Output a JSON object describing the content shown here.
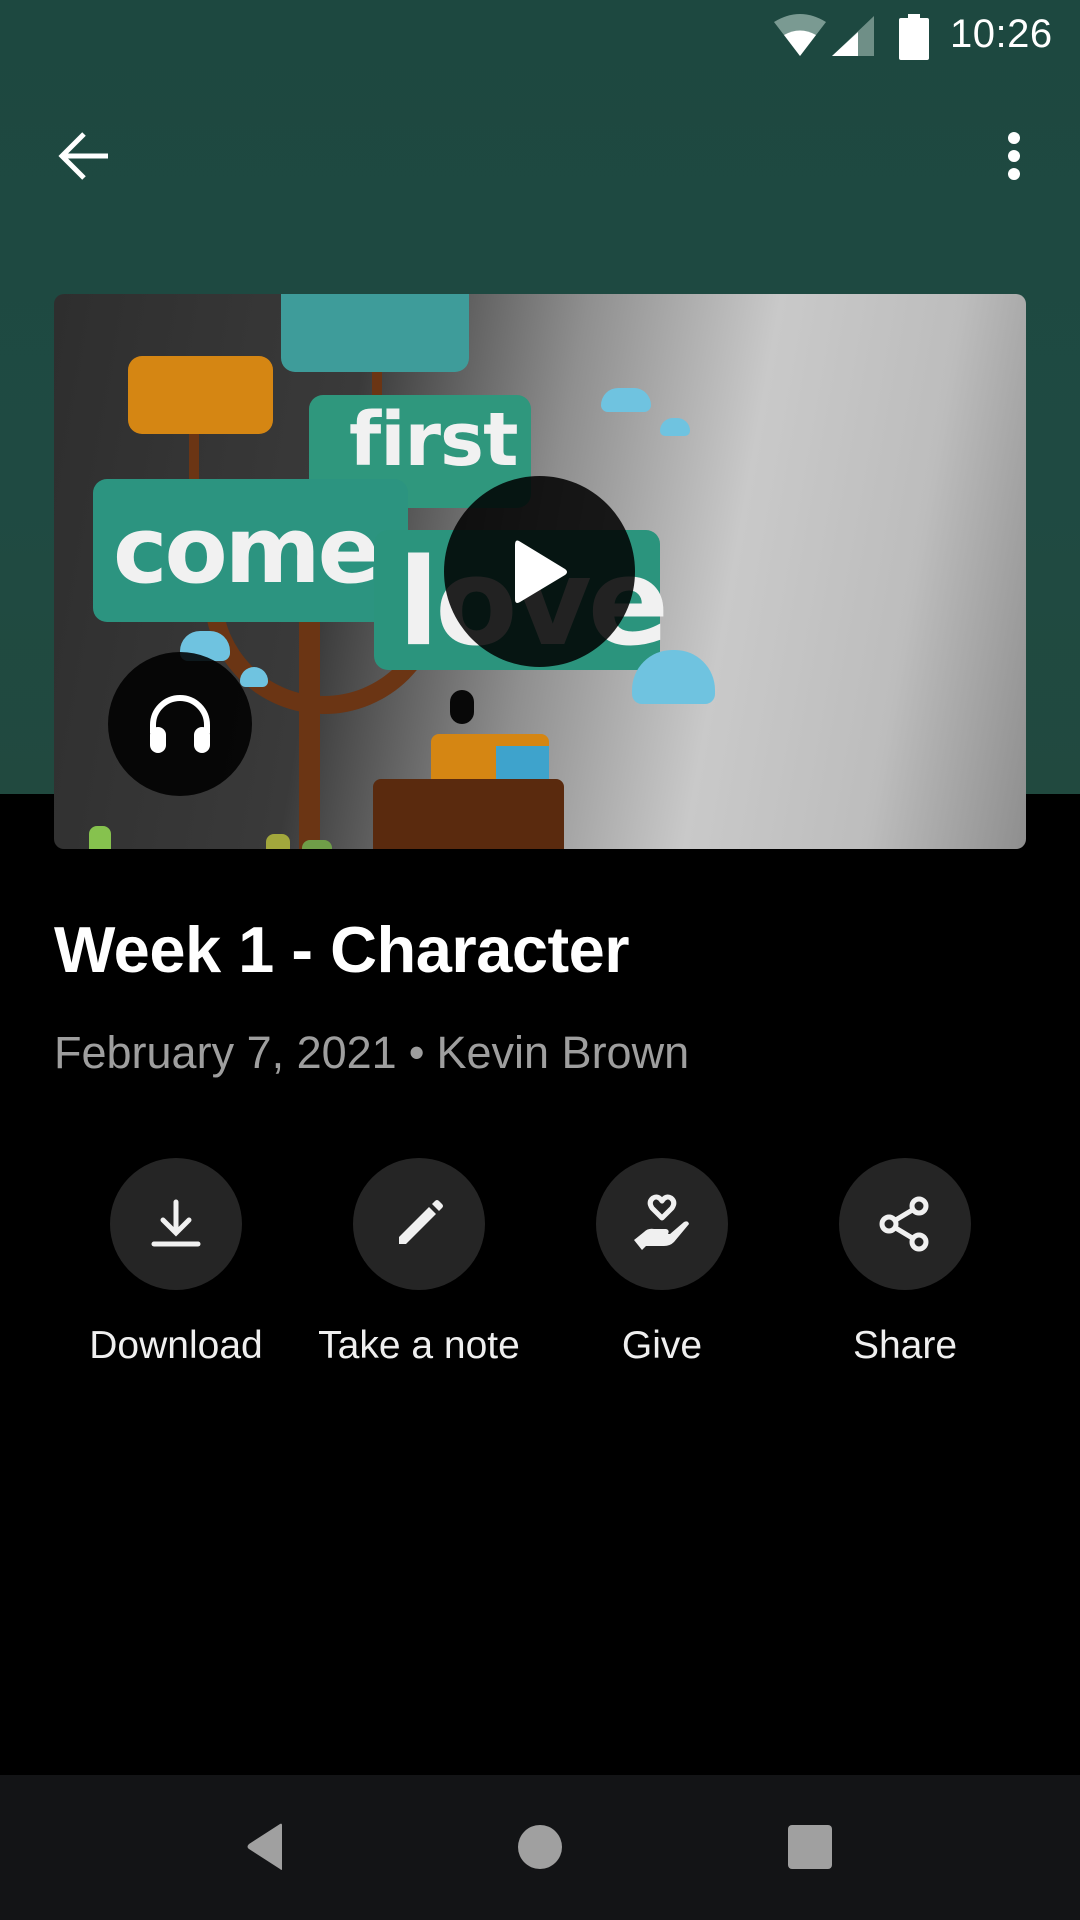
{
  "status_bar": {
    "time": "10:26",
    "icons": [
      "wifi-icon",
      "cellular-signal-icon",
      "battery-icon"
    ]
  },
  "app_bar": {
    "back_icon": "arrow-back-icon",
    "more_icon": "more-vert-icon"
  },
  "media": {
    "artwork_text": [
      "first",
      "comes",
      "love"
    ],
    "play_icon": "play-icon",
    "audio_icon": "headphones-icon"
  },
  "sermon": {
    "title": "Week 1 - Character",
    "date": "February 7, 2021",
    "separator": "•",
    "speaker": "Kevin Brown"
  },
  "actions": [
    {
      "label": "Download",
      "icon": "download-icon"
    },
    {
      "label": "Take a note",
      "icon": "pencil-icon"
    },
    {
      "label": "Give",
      "icon": "give-hand-heart-icon"
    },
    {
      "label": "Share",
      "icon": "share-icon"
    }
  ],
  "nav_bar": {
    "buttons": [
      "back",
      "home",
      "recents"
    ]
  },
  "colors": {
    "header_bg": "#1d4840",
    "page_bg": "#000000",
    "action_circle": "#252525",
    "meta_text": "#9e9e9e",
    "nav_bg": "#131416",
    "nav_icon": "#a0a0a0"
  }
}
